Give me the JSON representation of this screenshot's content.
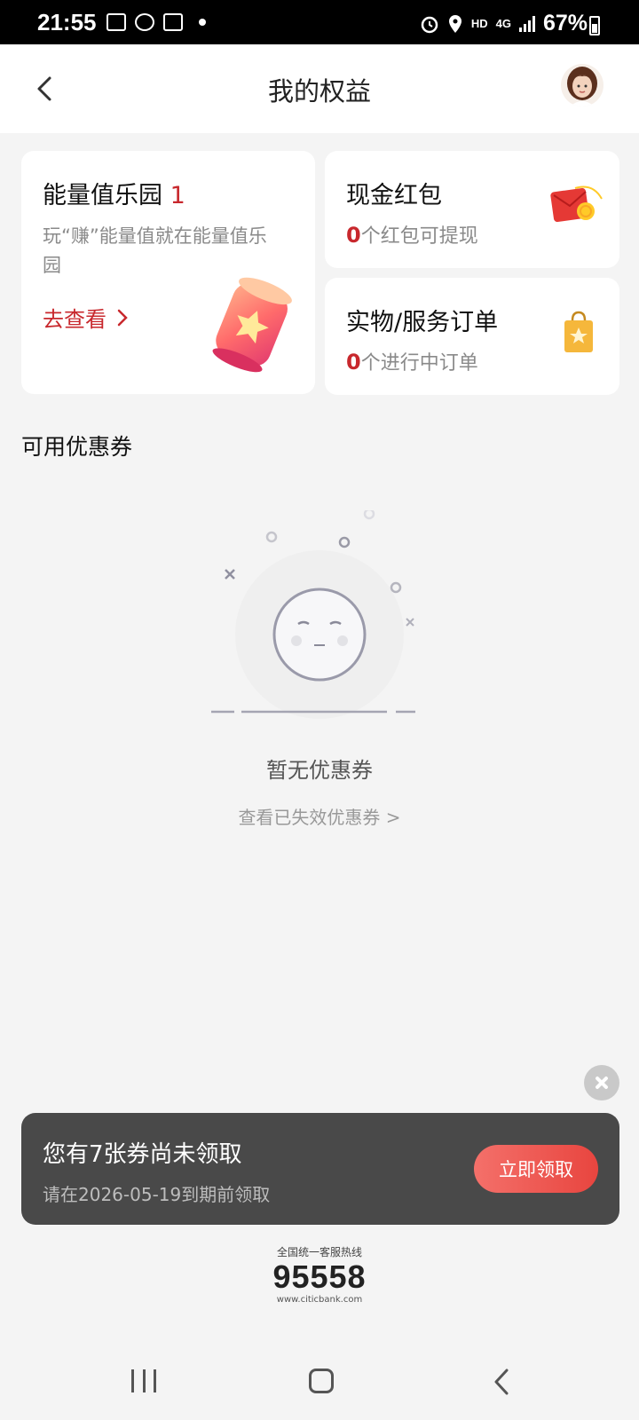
{
  "status_bar": {
    "time": "21:55",
    "hd": "HD",
    "network": "4G",
    "battery": "67%"
  },
  "header": {
    "title": "我的权益"
  },
  "cards": {
    "energy": {
      "title": "能量值乐园",
      "count": "1",
      "desc": "玩“赚”能量值就在能量值乐园",
      "link": "去查看"
    },
    "cash": {
      "title": "现金红包",
      "count": "0",
      "suffix": "个红包可提现"
    },
    "order": {
      "title": "实物/服务订单",
      "count": "0",
      "suffix": "个进行中订单"
    }
  },
  "coupons": {
    "section_title": "可用优惠券",
    "empty_text": "暂无优惠券",
    "expired_link": "查看已失效优惠券 >"
  },
  "banner": {
    "title": "您有7张券尚未领取",
    "subtitle": "请在2026-05-19到期前领取",
    "button": "立即领取"
  },
  "hotline": {
    "label": "全国统一客服热线",
    "number": "95558",
    "url": "www.citicbank.com"
  },
  "colors": {
    "accent_red": "#c8282d",
    "banner_bg": "#494949",
    "button_red": "#e8453f"
  }
}
